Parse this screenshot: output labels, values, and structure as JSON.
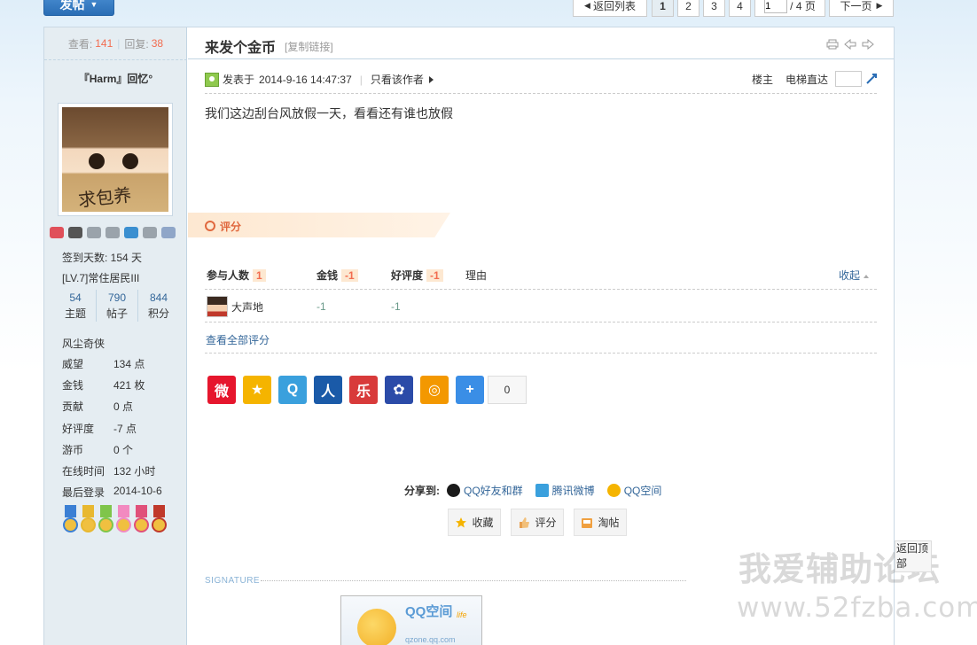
{
  "toolbar": {
    "post_label": "发帖",
    "back_list_label": "返回列表",
    "pages": [
      "1",
      "2",
      "3",
      "4"
    ],
    "current_page": "1",
    "page_input_value": "1",
    "total_pages_label": "/ 4 页",
    "next_page_label": "下一页"
  },
  "thread": {
    "views_label": "查看:",
    "views": "141",
    "replies_label": "回复:",
    "replies": "38",
    "title": "来发个金币",
    "copy_link_label": "[复制链接]"
  },
  "author": {
    "name": "『Harm』回忆°",
    "avatar_text": "求包养",
    "sign_days": "签到天数: 154 天",
    "level": "[LV.7]常住居民III",
    "stats": [
      {
        "value": "54",
        "label": "主题"
      },
      {
        "value": "790",
        "label": "帖子"
      },
      {
        "value": "844",
        "label": "积分"
      }
    ],
    "group": "风尘奇侠",
    "props": [
      {
        "key": "威望",
        "value": "134 点"
      },
      {
        "key": "金钱",
        "value": "421 枚"
      },
      {
        "key": "贡献",
        "value": "0 点"
      },
      {
        "key": "好评度",
        "value": "-7 点"
      },
      {
        "key": "游币",
        "value": "0 个"
      },
      {
        "key": "在线时间",
        "value": "132 小时"
      },
      {
        "key": "最后登录",
        "value": "2014-10-6"
      }
    ],
    "badge_colors": [
      "#e0505a",
      "#555555",
      "#9aa3ab",
      "#9aa3ab",
      "#3a8fd0",
      "#9aa3ab",
      "#8fa6c8"
    ],
    "medal_colors": [
      "#3b7fd4",
      "#e8b830",
      "#7fc54a",
      "#f28ac0",
      "#e0507a",
      "#c0392b"
    ]
  },
  "post": {
    "posted_prefix": "发表于",
    "posted_time": "2014-9-16 14:47:37",
    "only_author_label": "只看该作者",
    "floor_label": "楼主",
    "jump_label": "电梯直达",
    "content": "我们这边刮台风放假一天，看看还有谁也放假"
  },
  "rating": {
    "section_label": "评分",
    "participants_label": "参与人数",
    "participants": "1",
    "money_label": "金钱",
    "money_total": "-1",
    "reputation_label": "好评度",
    "reputation_total": "-1",
    "reason_label": "理由",
    "collapse_label": "收起",
    "rows": [
      {
        "user": "大声地",
        "money": "-1",
        "reputation": "-1"
      }
    ],
    "view_all_label": "查看全部评分"
  },
  "share": {
    "icons": [
      {
        "name": "weibo-icon",
        "color": "#e6162d",
        "glyph": "微"
      },
      {
        "name": "qzone-icon",
        "color": "#f5b400",
        "glyph": "★"
      },
      {
        "name": "tencent-weibo-icon",
        "color": "#3aa0dd",
        "glyph": "Q"
      },
      {
        "name": "renren-icon",
        "color": "#1a5aa8",
        "glyph": "人"
      },
      {
        "name": "kaixin-icon",
        "color": "#d83a3a",
        "glyph": "乐"
      },
      {
        "name": "baidu-icon",
        "color": "#2b4ba8",
        "glyph": "✿"
      },
      {
        "name": "qq-circle-icon",
        "color": "#f39800",
        "glyph": "◎"
      },
      {
        "name": "more-share-icon",
        "color": "#3a8ee6",
        "glyph": "+"
      }
    ],
    "count": "0",
    "share_to_label": "分享到:",
    "targets": [
      {
        "label": "QQ好友和群",
        "color": "#1a1a1a"
      },
      {
        "label": "腾讯微博",
        "color": "#3aa0dd"
      },
      {
        "label": "QQ空间",
        "color": "#f5b400"
      }
    ]
  },
  "actions": {
    "favorite_label": "收藏",
    "rate_label": "评分",
    "tao_label": "淘帖"
  },
  "signature": {
    "label": "SIGNATURE",
    "logo_title": "QQ空间",
    "logo_url": "qzone.qq.com",
    "logo_tag": "life"
  },
  "floating": {
    "back_top_label": "返回顶部"
  },
  "watermark": {
    "name": "我爱辅助论坛",
    "url": "www.52fzba.com"
  }
}
